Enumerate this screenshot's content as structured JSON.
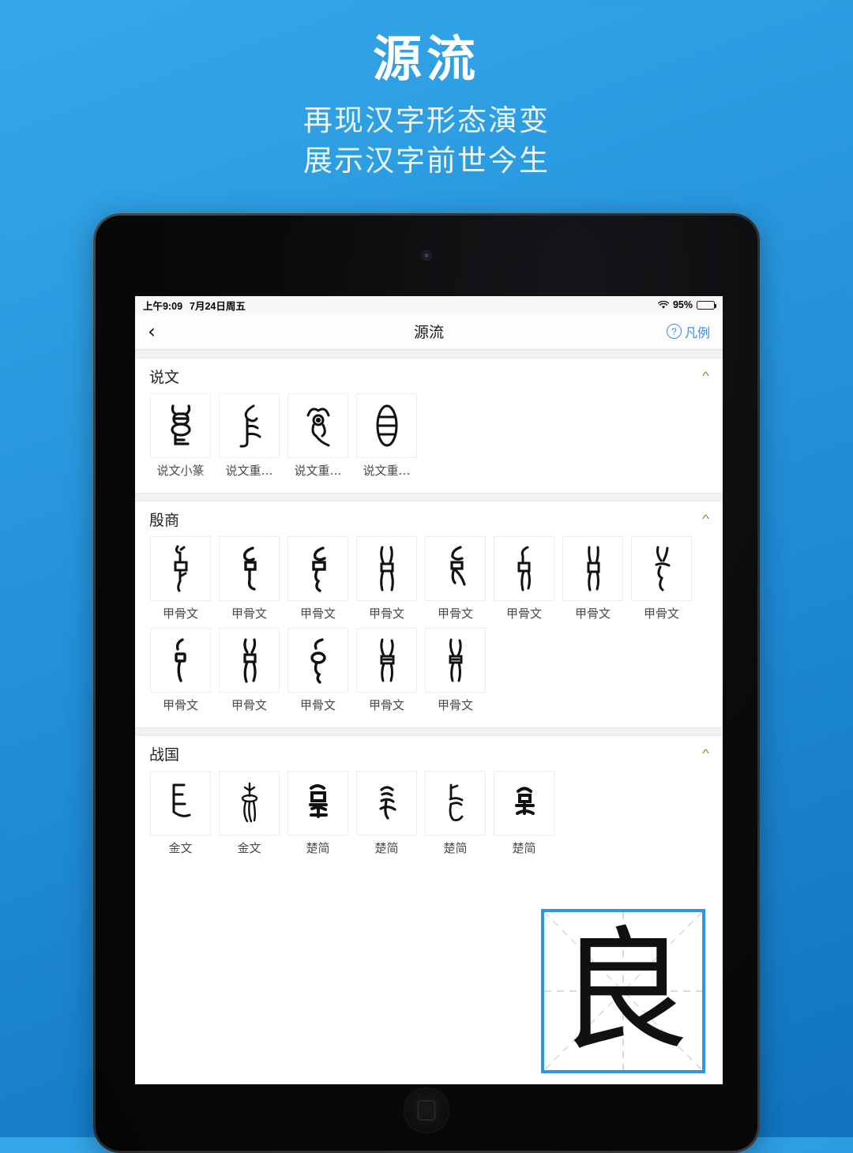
{
  "promo": {
    "title": "源流",
    "subtitle_line1": "再现汉字形态演变",
    "subtitle_line2": "展示汉字前世今生"
  },
  "status_bar": {
    "time": "上午9:09",
    "date": "7月24日周五",
    "wifi_icon": "wifi-icon",
    "battery_percent": "95%",
    "battery_level": 95
  },
  "nav_bar": {
    "back_icon": "chevron-left-icon",
    "title": "源流",
    "help_icon": "question-circle-icon",
    "help_label": "凡例"
  },
  "colors": {
    "accent_blue": "#3c8ae8",
    "card_border_blue": "#2f96e0",
    "chevron_gold": "#a8842c",
    "background_top": "#35a8e8",
    "background_bottom": "#1073be"
  },
  "sections": [
    {
      "title": "说文",
      "collapse_icon": "chevron-up-icon",
      "items": [
        {
          "label": "说文小篆",
          "glyph": "seal-script-liang-1"
        },
        {
          "label": "说文重…",
          "glyph": "seal-script-liang-2"
        },
        {
          "label": "说文重…",
          "glyph": "seal-script-liang-3"
        },
        {
          "label": "说文重…",
          "glyph": "seal-script-liang-4"
        }
      ]
    },
    {
      "title": "殷商",
      "collapse_icon": "chevron-up-icon",
      "items": [
        {
          "label": "甲骨文",
          "glyph": "oracle-bone-liang-1"
        },
        {
          "label": "甲骨文",
          "glyph": "oracle-bone-liang-2"
        },
        {
          "label": "甲骨文",
          "glyph": "oracle-bone-liang-3"
        },
        {
          "label": "甲骨文",
          "glyph": "oracle-bone-liang-4"
        },
        {
          "label": "甲骨文",
          "glyph": "oracle-bone-liang-5"
        },
        {
          "label": "甲骨文",
          "glyph": "oracle-bone-liang-6"
        },
        {
          "label": "甲骨文",
          "glyph": "oracle-bone-liang-7"
        },
        {
          "label": "甲骨文",
          "glyph": "oracle-bone-liang-8"
        },
        {
          "label": "甲骨文",
          "glyph": "oracle-bone-liang-9"
        },
        {
          "label": "甲骨文",
          "glyph": "oracle-bone-liang-10"
        },
        {
          "label": "甲骨文",
          "glyph": "oracle-bone-liang-11"
        },
        {
          "label": "甲骨文",
          "glyph": "oracle-bone-liang-12"
        },
        {
          "label": "甲骨文",
          "glyph": "oracle-bone-liang-13"
        }
      ]
    },
    {
      "title": "战国",
      "collapse_icon": "chevron-up-icon",
      "items": [
        {
          "label": "金文",
          "glyph": "bronze-script-liang-1"
        },
        {
          "label": "金文",
          "glyph": "bronze-script-liang-2"
        },
        {
          "label": "楚简",
          "glyph": "chu-slip-liang-1"
        },
        {
          "label": "楚简",
          "glyph": "chu-slip-liang-2"
        },
        {
          "label": "楚简",
          "glyph": "chu-slip-liang-3"
        },
        {
          "label": "楚简",
          "glyph": "chu-slip-liang-4"
        }
      ]
    }
  ],
  "character_card": {
    "character": "良",
    "grid_style": "mizige"
  }
}
